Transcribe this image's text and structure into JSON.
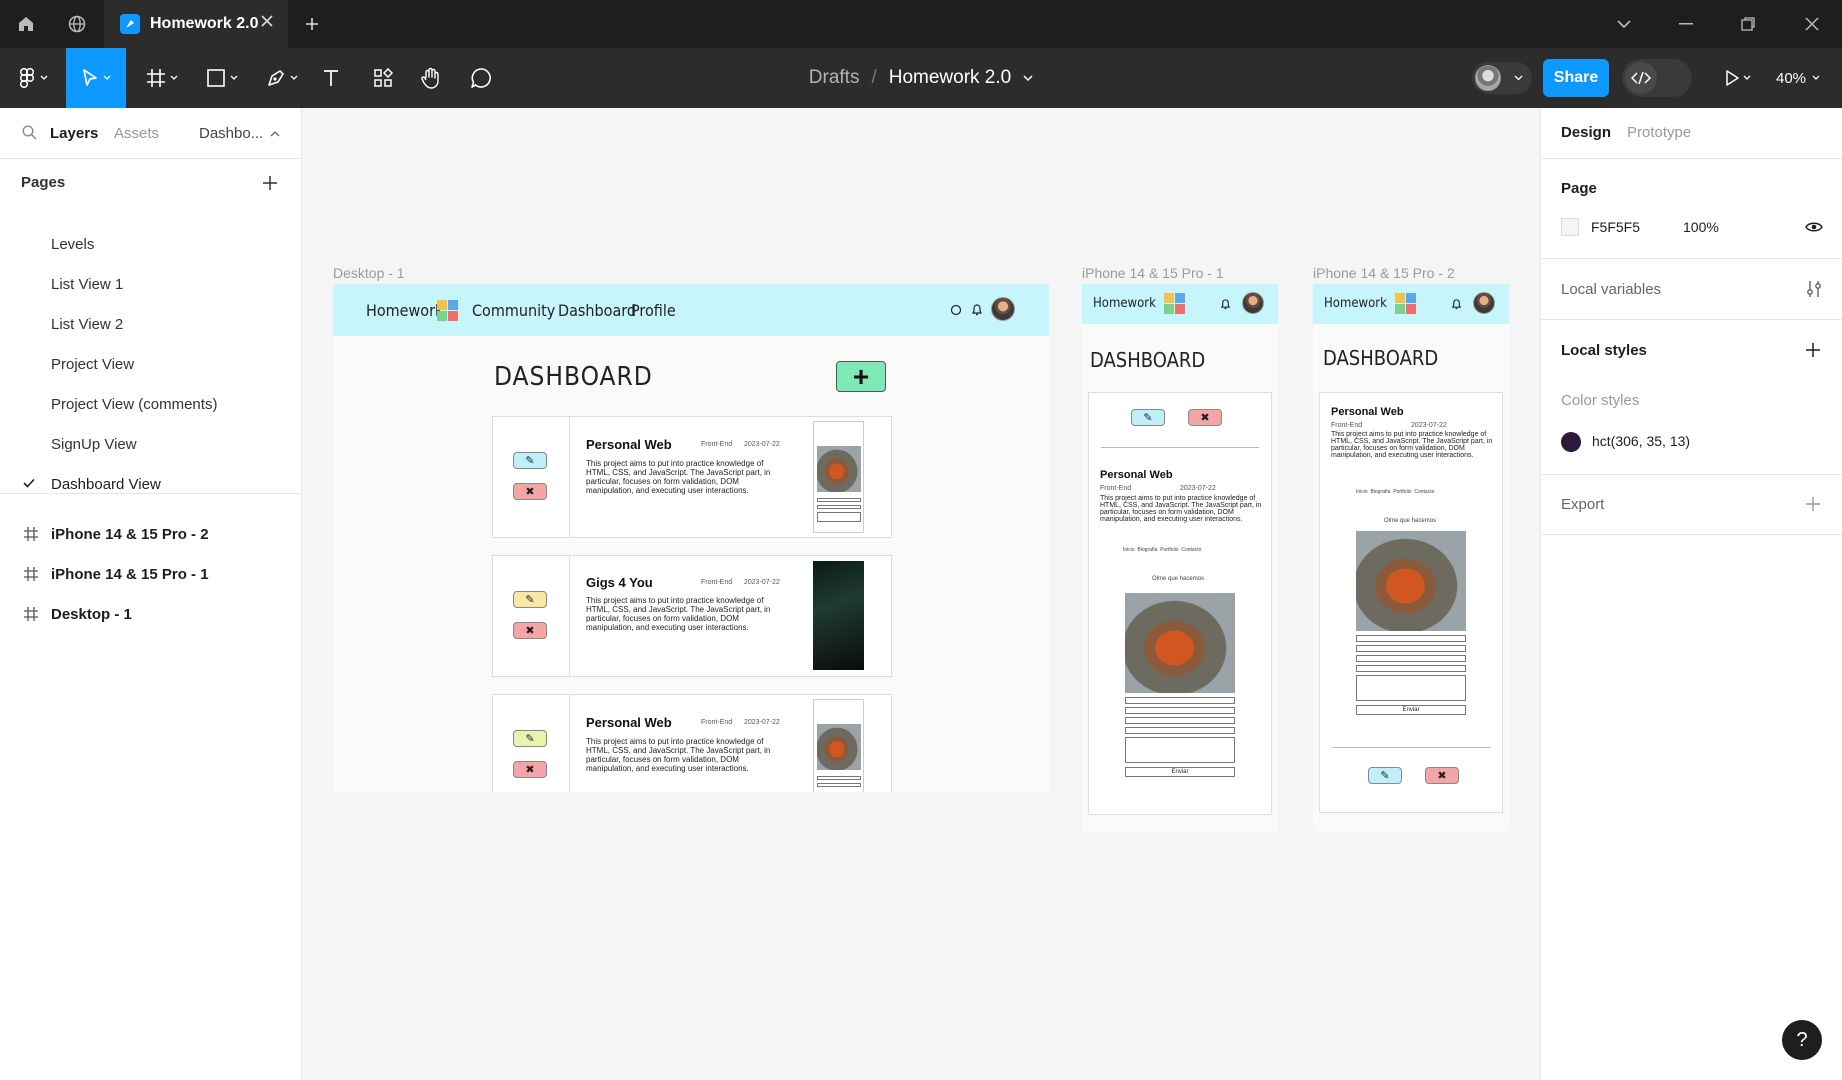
{
  "tabbar": {
    "active_tab": "Homework 2.0"
  },
  "toolbar": {
    "breadcrumb_drafts": "Drafts",
    "breadcrumb_sep": "/",
    "file_name": "Homework 2.0",
    "share_label": "Share",
    "zoom": "40%"
  },
  "left_panel": {
    "tabs": {
      "layers": "Layers",
      "assets": "Assets",
      "page_menu": "Dashbo..."
    },
    "pages_title": "Pages",
    "pages": [
      {
        "label": "Levels"
      },
      {
        "label": "List View 1"
      },
      {
        "label": "List View 2"
      },
      {
        "label": "Project View"
      },
      {
        "label": "Project View (comments)"
      },
      {
        "label": "SignUp View"
      },
      {
        "label": "Dashboard View",
        "selected": true
      }
    ],
    "layers": [
      {
        "label": "iPhone 14 & 15 Pro - 2"
      },
      {
        "label": "iPhone 14 & 15 Pro - 1"
      },
      {
        "label": "Desktop - 1"
      }
    ]
  },
  "right_panel": {
    "tab_design": "Design",
    "tab_prototype": "Prototype",
    "page_title": "Page",
    "page_color": "F5F5F5",
    "page_opacity": "100%",
    "local_variables": "Local variables",
    "local_styles": "Local styles",
    "color_styles_title": "Color styles",
    "color_style_name": "hct(306, 35, 13)",
    "color_style_swatch": "#2a1b3d",
    "export": "Export"
  },
  "canvas": {
    "desktop_label": "Desktop - 1",
    "iphone1_label": "iPhone 14 & 15 Pro - 1",
    "iphone2_label": "iPhone 14 & 15 Pro - 2",
    "nav": {
      "brand": "Homework",
      "community": "Community",
      "dashboard": "Dashboard",
      "profile": "Profile"
    },
    "dashboard_heading": "DASHBOARD",
    "cards": [
      {
        "title": "Personal Web",
        "category": "Front-End",
        "date": "2023-07-22",
        "description": "This project aims to put into practice knowledge of HTML, CSS, and JavaScript. The JavaScript part, in particular, focuses on form validation, DOM manipulation, and executing user interactions."
      },
      {
        "title": "Gigs 4 You",
        "category": "Front-End",
        "date": "2023-07-22",
        "description": "This project aims to put into practice knowledge of HTML, CSS, and JavaScript. The JavaScript part, in particular, focuses on form validation, DOM manipulation, and executing user interactions."
      },
      {
        "title": "Personal Web",
        "category": "Front-End",
        "date": "2023-07-22",
        "description": "This project aims to put into practice knowledge of HTML, CSS, and JavaScript. The JavaScript part, in particular, focuses on form validation, DOM manipulation, and executing user interactions."
      }
    ],
    "edit_glyph": "✎",
    "delete_glyph": "✖",
    "add_glyph": "+",
    "preview": {
      "nav": "Inicio  Biografía  Portfolio  Contacto",
      "heading": "Olme que hacemos",
      "send": "Enviar"
    }
  },
  "help_glyph": "?"
}
